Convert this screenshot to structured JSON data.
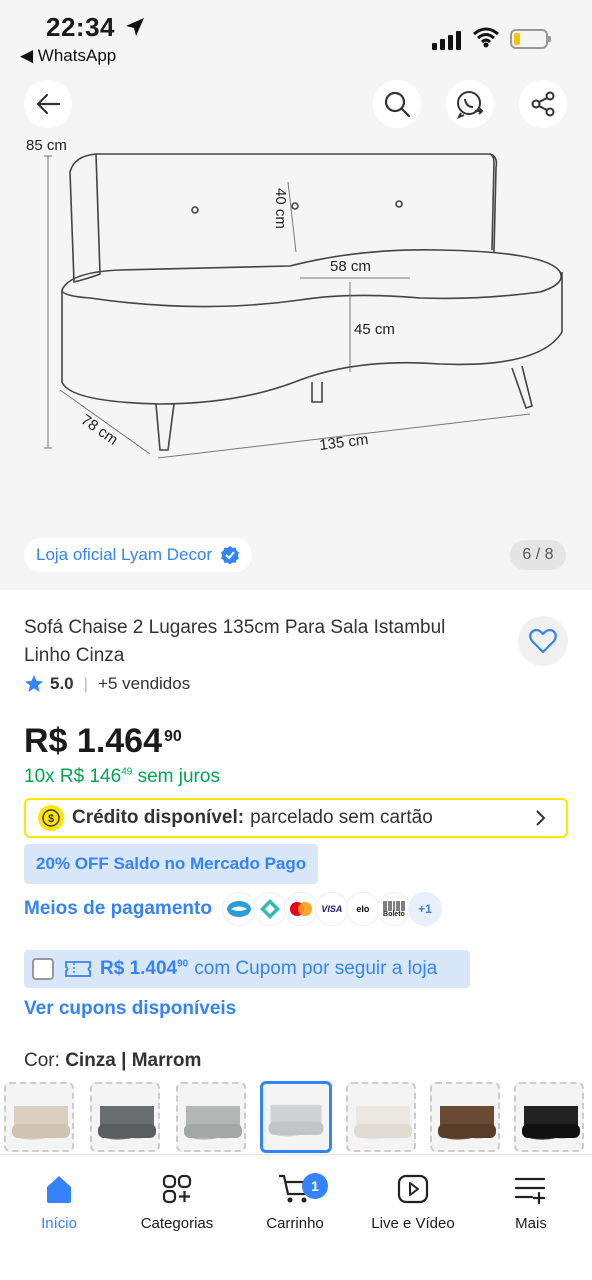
{
  "status_bar": {
    "time": "22:34",
    "back_app": "◀ WhatsApp"
  },
  "gallery": {
    "dims": {
      "height": "85 cm",
      "back": "40 cm",
      "seat_depth": "58 cm",
      "seat_height": "45 cm",
      "depth": "78 cm",
      "width": "135 cm"
    },
    "official_store": "Loja oficial Lyam Decor",
    "counter": "6 / 8"
  },
  "product": {
    "title": "Sofá Chaise 2 Lugares 135cm Para Sala Istambul Linho Cinza",
    "rating": "5.0",
    "sold": "+5 vendidos",
    "price_main": "R$ 1.464",
    "price_cents": "90",
    "installments_prefix": "10x R$ 146",
    "installments_cents": "49",
    "installments_suffix": " sem juros"
  },
  "credit": {
    "label": "Crédito disponível:",
    "text": "parcelado sem cartão"
  },
  "discount_badge": "20% OFF Saldo no Mercado Pago",
  "payments": {
    "label": "Meios de pagamento",
    "methods": [
      "mercado-pago",
      "pix",
      "mastercard",
      "VISA",
      "elo",
      "Boleto"
    ],
    "more": "+1"
  },
  "coupon": {
    "amount": "R$ 1.404",
    "cents": "90",
    "text": "com Cupom por seguir a loja"
  },
  "see_coupons": "Ver cupons disponíveis",
  "color": {
    "label": "Cor:",
    "value": "Cinza | Marrom",
    "swatches": [
      "bege",
      "cinza-escuro",
      "cinza-claro",
      "cinza",
      "off-white",
      "marrom",
      "preto"
    ]
  },
  "nav": {
    "items": [
      {
        "label": "Início",
        "icon": "home-icon"
      },
      {
        "label": "Categorias",
        "icon": "categories-icon"
      },
      {
        "label": "Carrinho",
        "icon": "cart-icon"
      },
      {
        "label": "Live e Vídeo",
        "icon": "play-icon"
      },
      {
        "label": "Mais",
        "icon": "menu-icon"
      }
    ],
    "cart_count": "1"
  },
  "colors": {
    "brand_blue": "#3483fa",
    "green": "#00a650",
    "yellow": "#ffe600"
  }
}
